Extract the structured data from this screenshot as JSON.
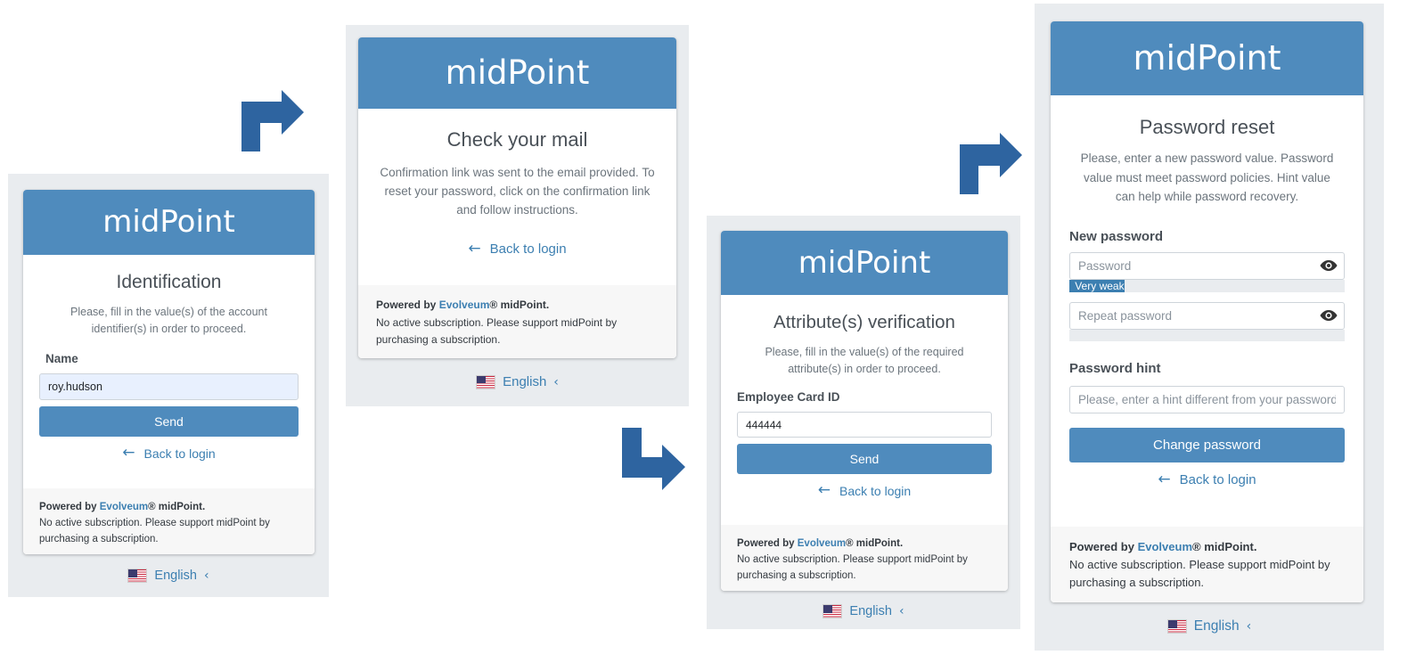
{
  "brand": "midPoint",
  "colors": {
    "header": "#4f8bbd",
    "button": "#4f8bbd",
    "link": "#3c7fb1",
    "flow_arrow": "#2e64a0",
    "panel": "#e9ecef"
  },
  "footer": {
    "powered_by": "Powered by",
    "vendor": "Evolveum",
    "reg": "®",
    "product": " midPoint.",
    "note": "No active subscription. Please support midPoint by purchasing a subscription."
  },
  "language": {
    "label": "English",
    "chevron": "‹",
    "flag_icon": "us-flag-icon"
  },
  "back_label": "Back to login",
  "back_icon": "arrow-left-icon",
  "step1": {
    "title": "Identification",
    "description": "Please, fill in the value(s) of the account identifier(s) in order to proceed.",
    "field_label": "Name",
    "field_value": "roy.hudson",
    "button": "Send"
  },
  "step2": {
    "title": "Check your mail",
    "description": "Confirmation link was sent to the email provided. To reset your password, click on the confirmation link and follow instructions."
  },
  "step3": {
    "title": "Attribute(s) verification",
    "description": "Please, fill in the value(s) of the required attribute(s) in order to proceed.",
    "field_label": "Employee Card ID",
    "field_value": "444444",
    "button": "Send"
  },
  "step4": {
    "title": "Password reset",
    "description": "Please, enter a new password value. Password value must meet password policies. Hint value can help while password recovery.",
    "new_password_label": "New password",
    "password_placeholder": "Password",
    "strength": "Very weak",
    "strength_level": 0.2,
    "repeat_placeholder": "Repeat password",
    "hint_label": "Password hint",
    "hint_placeholder": "Please, enter a hint different from your password",
    "button": "Change password"
  }
}
